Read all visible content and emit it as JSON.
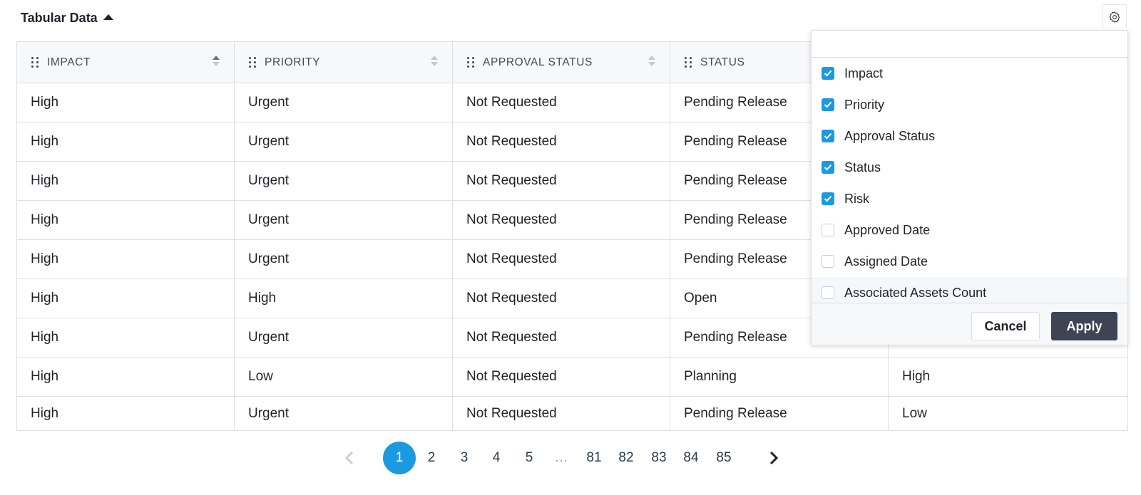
{
  "header": {
    "title": "Tabular Data"
  },
  "colors": {
    "accent": "#1b9ae0",
    "apply_button": "#3e4453",
    "header_bg": "#f7f8f9",
    "border": "#dcdfe3"
  },
  "table": {
    "columns": [
      "IMPACT",
      "PRIORITY",
      "APPROVAL STATUS",
      "STATUS",
      ""
    ],
    "rows": [
      [
        "High",
        "Urgent",
        "Not Requested",
        "Pending Release",
        ""
      ],
      [
        "High",
        "Urgent",
        "Not Requested",
        "Pending Release",
        ""
      ],
      [
        "High",
        "Urgent",
        "Not Requested",
        "Pending Release",
        ""
      ],
      [
        "High",
        "Urgent",
        "Not Requested",
        "Pending Release",
        ""
      ],
      [
        "High",
        "Urgent",
        "Not Requested",
        "Pending Release",
        ""
      ],
      [
        "High",
        "High",
        "Not Requested",
        "Open",
        ""
      ],
      [
        "High",
        "Urgent",
        "Not Requested",
        "Pending Release",
        ""
      ],
      [
        "High",
        "Low",
        "Not Requested",
        "Planning",
        "High"
      ],
      [
        "High",
        "Urgent",
        "Not Requested",
        "Pending Release",
        "Low"
      ]
    ]
  },
  "column_picker": {
    "search_placeholder": "",
    "items": [
      {
        "label": "Impact",
        "checked": true
      },
      {
        "label": "Priority",
        "checked": true
      },
      {
        "label": "Approval Status",
        "checked": true
      },
      {
        "label": "Status",
        "checked": true
      },
      {
        "label": "Risk",
        "checked": true
      },
      {
        "label": "Approved Date",
        "checked": false
      },
      {
        "label": "Assigned Date",
        "checked": false
      },
      {
        "label": "Associated Assets Count",
        "checked": false
      }
    ],
    "cancel_label": "Cancel",
    "apply_label": "Apply"
  },
  "pagination": {
    "current": "1",
    "pages": [
      "1",
      "2",
      "3",
      "4",
      "5",
      "…",
      "81",
      "82",
      "83",
      "84",
      "85"
    ]
  },
  "icons": {
    "settings": "gear-icon",
    "prev": "chevron-left-icon",
    "next": "chevron-right-icon",
    "sort": "sort-icon",
    "drag": "drag-handle-icon"
  }
}
